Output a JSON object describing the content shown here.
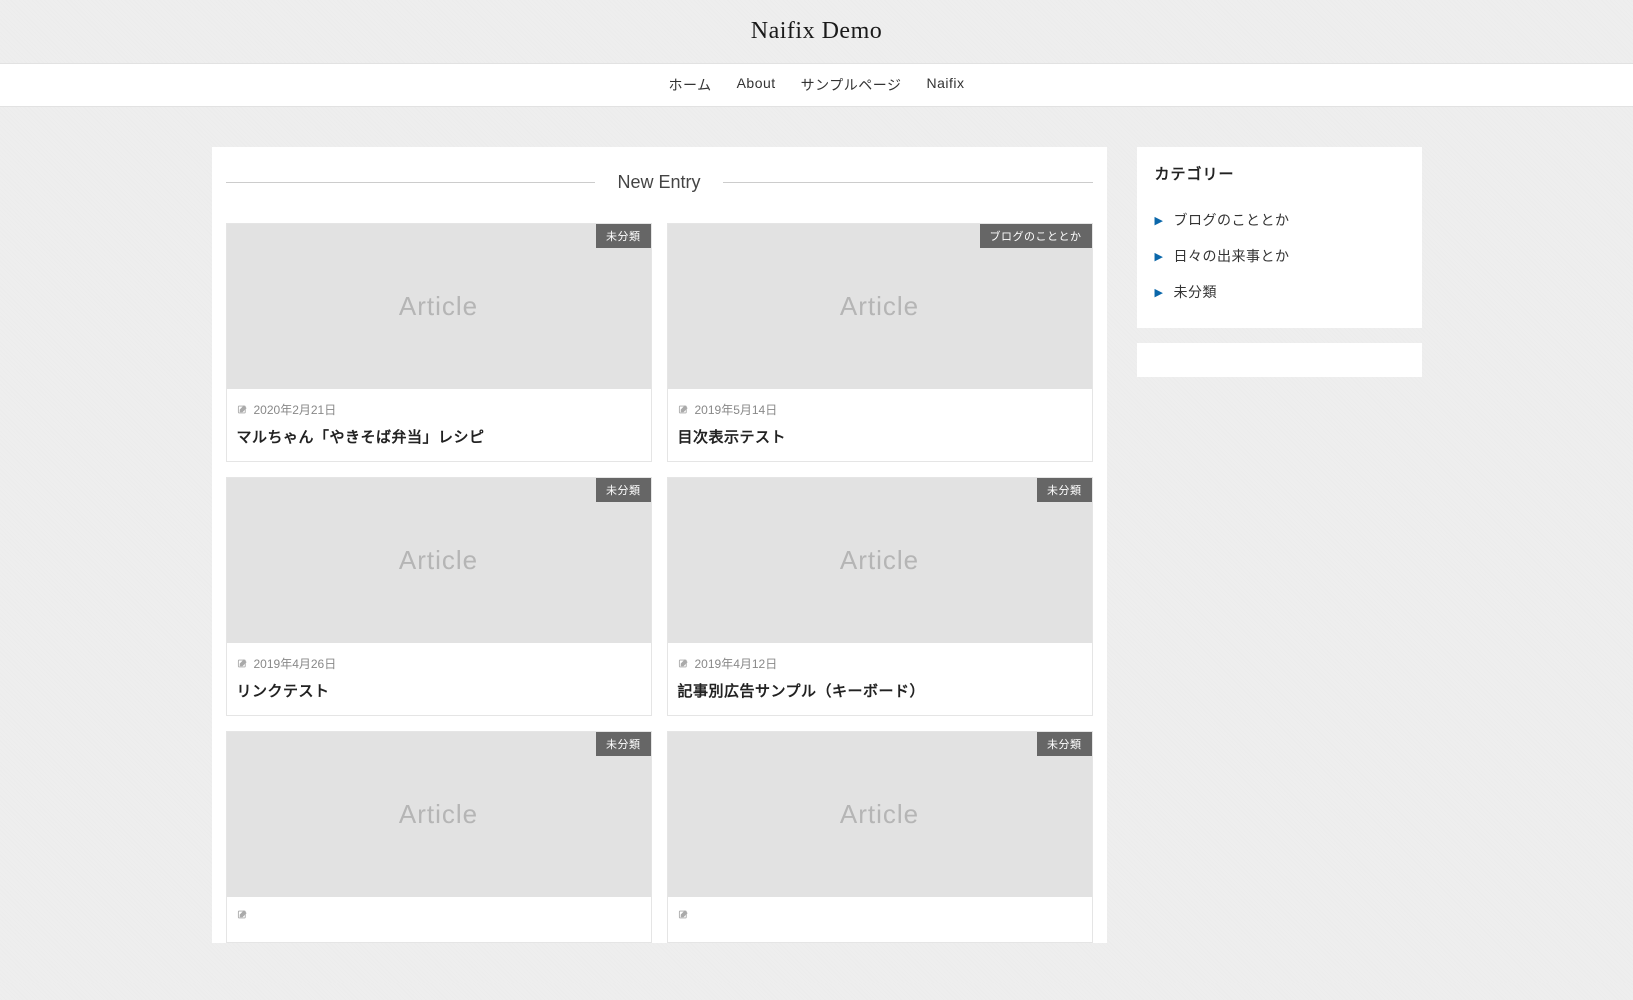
{
  "header": {
    "site_title": "Naifix Demo"
  },
  "nav": {
    "items": [
      {
        "label": "ホーム"
      },
      {
        "label": "About"
      },
      {
        "label": "サンプルページ"
      },
      {
        "label": "Naifix"
      }
    ]
  },
  "main": {
    "section_title": "New Entry",
    "thumb_placeholder": "Article",
    "posts": [
      {
        "category": "未分類",
        "date": "2020年2月21日",
        "title": "マルちゃん「やきそば弁当」レシピ"
      },
      {
        "category": "ブログのこととか",
        "date": "2019年5月14日",
        "title": "目次表示テスト"
      },
      {
        "category": "未分類",
        "date": "2019年4月26日",
        "title": "リンクテスト"
      },
      {
        "category": "未分類",
        "date": "2019年4月12日",
        "title": "記事別広告サンプル（キーボード）"
      },
      {
        "category": "未分類",
        "date": "",
        "title": ""
      },
      {
        "category": "未分類",
        "date": "",
        "title": ""
      }
    ]
  },
  "sidebar": {
    "category_widget": {
      "title": "カテゴリー",
      "items": [
        {
          "label": "ブログのこととか"
        },
        {
          "label": "日々の出来事とか"
        },
        {
          "label": "未分類"
        }
      ]
    }
  }
}
